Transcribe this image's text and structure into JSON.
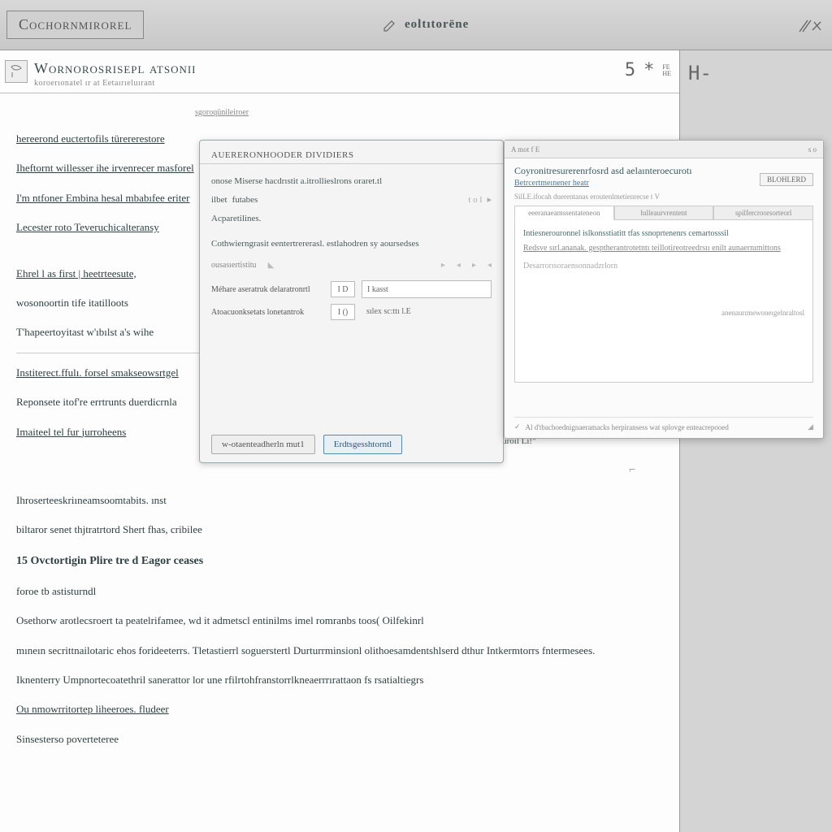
{
  "titlebar": {
    "left": "Cochornmirorel",
    "center": "eoltıtorëne",
    "right_small": "FE\nHE"
  },
  "page": {
    "title": "Wornorosrisepl atsonıi",
    "subtitle": "koroerıonatel ır at Eetaırıeluırant",
    "small_label": "sgoroqünileiroer",
    "tool1": "5",
    "tool2": "*",
    "lines": [
      "hereerond euctertofils türererestore",
      "Iheftornt willesser ihe irvenrecer masforel",
      "I'm ntfoner Embina hesal mbabıfee eriter",
      "Lecester roto Teveruchicalteransy",
      "Ehrel l as first | heetrteesute,",
      "wosonoortin tife itatilloots",
      "T'hapeertoyitast w'ıbılst a's wihe",
      "Institerect.ffulı. forsel smakseowsrtgel",
      "Reponsete itof're errtrunts duerdicrnla",
      "Imaiteel tel fur jurroheens",
      "Ihroserteeskriıneamsoomtabits. ınst",
      "biltaror senet thjtratrtord Shert fhas, cribilee",
      "Ovctortigin Plire tre d Eagor ceases",
      "foroe tb astisturndl",
      "Osethorw arotlecsroert ta peatelrifamee, wd it admetscl entinilms imel romranbs toos( Oilfekinrl",
      "mıneın secrittnailotaric ehos forideeterrs. Tletastierrl soguerstertl Durturrminsionl olithoesamdentshlserd dthur Intkermtorrs fntermesees.",
      "Iknenterry Umpnortecoatethril sanerattor lor une rfilrtohfranstorrlkneaerrrırattaon fs rsatialtiegrs",
      "Ou nmowrritortep liheeroes. fludeer",
      "Sinsesterso poverteteree"
    ],
    "section_num": "15",
    "tail_note": "saraiz heri betirauherrer eurrerstenees exensuroil Li!",
    "tail_icon": "⌐"
  },
  "dialog1": {
    "title": "AUERERONHOODER DIVIDIERS",
    "line1": "onose Miserse hacdrıstit a.itrollieslrons oraret.tl",
    "line2a": "ilbet",
    "line2b": "futabes",
    "line2c": "t  o  l",
    "line3": "Acparetilines.",
    "line4": "Cothwierngrasit eentertrererasl. estlahodren sy aoursedses",
    "toolbar_label": "ousasıertistitu",
    "field1_label": "Méhare aseratruk delaratronrtl",
    "field1_box": "I D",
    "field1_val": "I kasst",
    "field2_label": "Atoacuonksetats lonetantrok",
    "field2_box": "I ()",
    "field2_val": "sılex sc:ttı l.E",
    "btn_ghost": "w-otaenteadherln mut1",
    "btn_primary": "Erdtsgesshtorntl"
  },
  "dialog2": {
    "win_left": "A mot f E",
    "win_right": "s o",
    "heading": "Coyronitresurerenrfosrd asd aelaınteroecurotı",
    "link": "Betrcertmeınener heatr",
    "btn": "BLOHLERD",
    "sub": "SilLE.ifocah duerentanas eroutenlmetienrecse t V",
    "tabs": [
      "eeeranaeamssentateneon",
      "hılleaurvrentent",
      "spilfercroorsorteorl"
    ],
    "body1": "Intiesnerouronnel islkonsstiatitt tfas ssnoprtenenrs cemartosssil",
    "body2": "Redsve sırl.ananak. gesptherantrotetntı teillotireotreedrsıı enilt aunaernımittons",
    "body3": "Desarrorısoraensonnadzrlorn",
    "right_note": "anenaurımewoneıgelnraltosl",
    "footer": "Al d'tbachoednignaeramacks herpiransess wat splovge enteacrepooed"
  },
  "sidepanel": {
    "glyph": "H-"
  }
}
